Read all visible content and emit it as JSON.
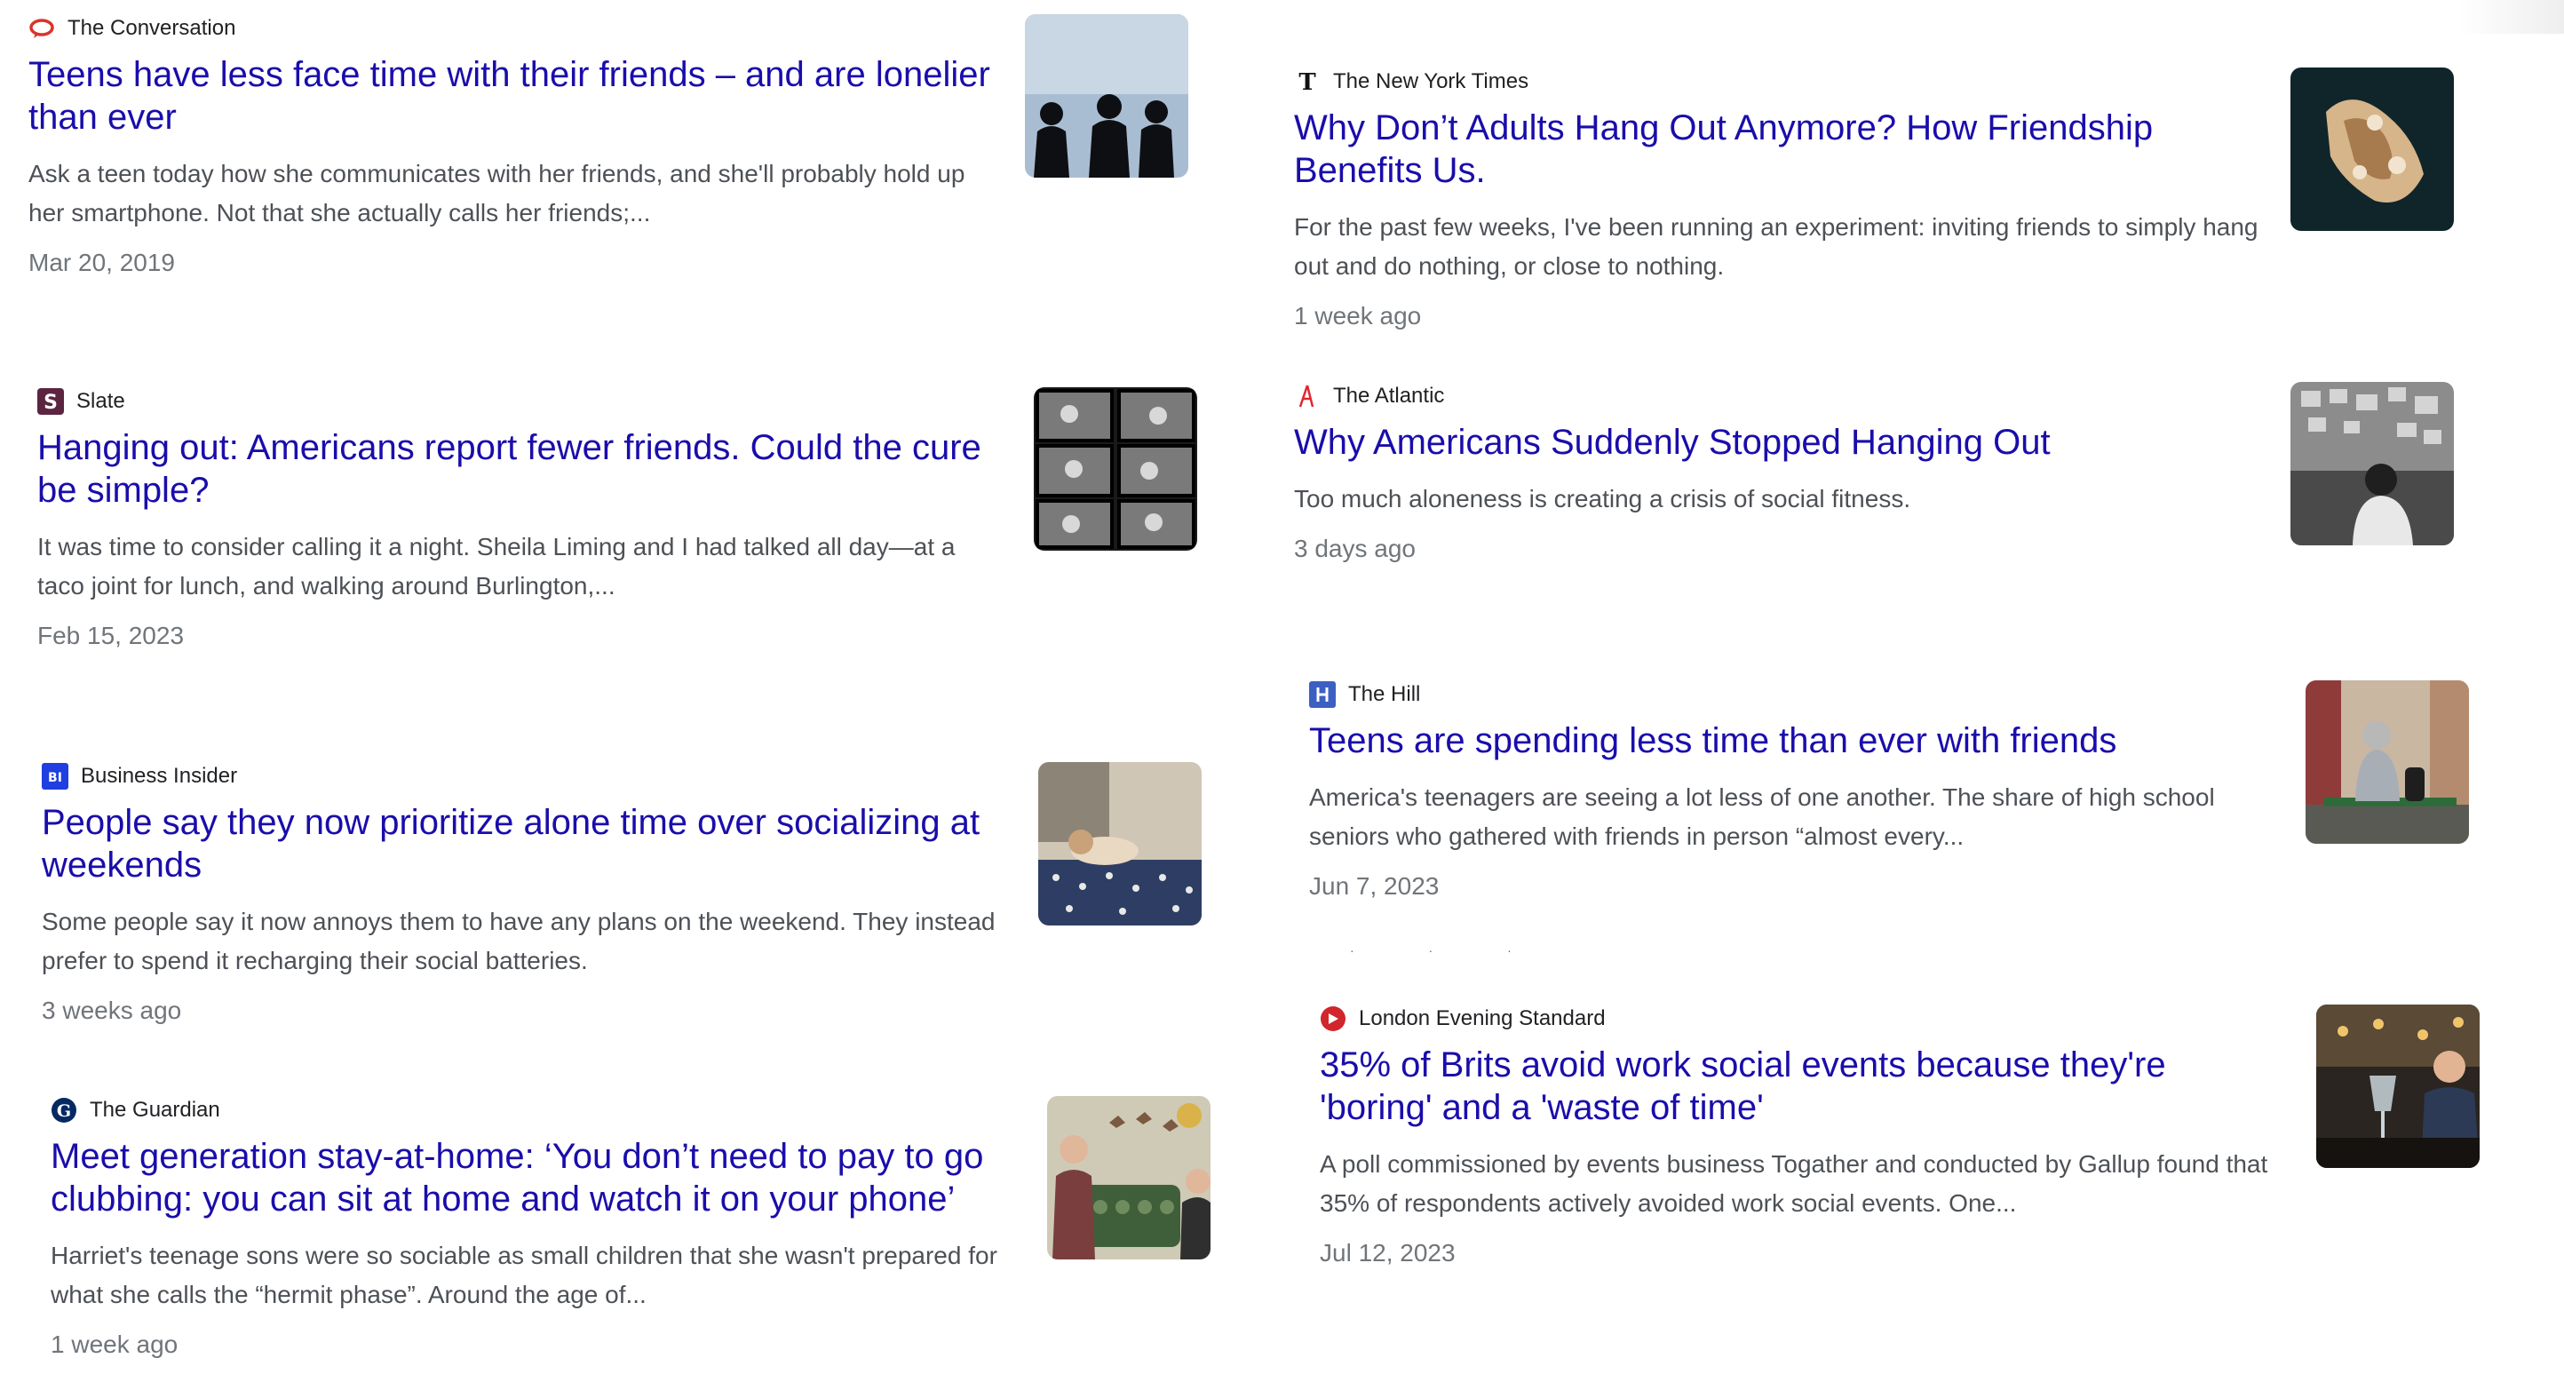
{
  "articles": [
    {
      "source": "The Conversation",
      "source_icon": "speech-bubble-icon",
      "title": "Teens have less face time with their friends – and are lonelier than ever",
      "snippet": "Ask a teen today how she communicates with her friends, and she'll probably hold up her smartphone. Not that she actually calls her friends;...",
      "date": "Mar 20, 2019"
    },
    {
      "source": "The New York Times",
      "source_icon": "nyt-t-icon",
      "title": "Why Don’t Adults Hang Out Anymore? How Friendship Benefits Us.",
      "snippet": "For the past few weeks, I've been running an experiment: inviting friends to simply hang out and do nothing, or close to nothing.",
      "date": "1 week ago"
    },
    {
      "source": "Slate",
      "source_icon": "slate-s-icon",
      "title": "Hanging out: Americans report fewer friends. Could the cure be simple?",
      "snippet": "It was time to consider calling it a night. Sheila Liming and I had talked all day—at a taco joint for lunch, and walking around Burlington,...",
      "date": "Feb 15, 2023"
    },
    {
      "source": "The Atlantic",
      "source_icon": "atlantic-a-icon",
      "title": "Why Americans Suddenly Stopped Hanging Out",
      "snippet": "Too much aloneness is creating a crisis of social fitness.",
      "date": "3 days ago"
    },
    {
      "source": "Business Insider",
      "source_icon": "bi-icon",
      "source_icon_text": "BI",
      "title": "People say they now prioritize alone time over socializing at weekends",
      "snippet": "Some people say it now annoys them to have any plans on the weekend. They instead prefer to spend it recharging their social batteries.",
      "date": "3 weeks ago"
    },
    {
      "source": "The Hill",
      "source_icon": "the-hill-icon",
      "title": "Teens are spending less time than ever with friends",
      "snippet": "America's teenagers are seeing a lot less of one another. The share of high school seniors who gathered with friends in person “almost every...",
      "date": "Jun 7, 2023"
    },
    {
      "source": "The Guardian",
      "source_icon": "guardian-g-icon",
      "title": "Meet generation stay-at-home: ‘You don’t need to pay to go clubbing: you can sit at home and watch it on your phone’",
      "snippet": "Harriet's teenage sons were so sociable as small children that she wasn't prepared for what she calls the “hermit phase”. Around the age of...",
      "date": "1 week ago"
    },
    {
      "source": "London Evening Standard",
      "source_icon": "standard-icon",
      "title": "35% of Brits avoid work social events because they're 'boring' and a 'waste of time'",
      "snippet": "A poll commissioned by events business Togather and conducted by Gallup found that 35% of respondents actively avoided work social events. One...",
      "date": "Jul 12, 2023"
    }
  ],
  "colors": {
    "title": "#1a0dab",
    "snippet": "#4d5156",
    "date": "#70757a",
    "source": "#202124"
  }
}
